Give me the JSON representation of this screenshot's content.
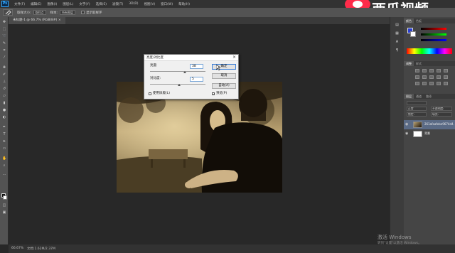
{
  "menubar": {
    "logo": "Ps",
    "items": [
      "文件(F)",
      "编辑(E)",
      "图像(I)",
      "图层(L)",
      "文字(Y)",
      "选择(S)",
      "滤镜(T)",
      "3D(D)",
      "视图(V)",
      "窗口(W)",
      "帮助(H)"
    ]
  },
  "options_bar": {
    "sample_size_label": "取样大小:",
    "sample_size_value": "取样点",
    "sample_label": "样本:",
    "sample_value": "所有图层",
    "show_ring_label": "显示取样环"
  },
  "document_tab": {
    "title": "未标题-1 @ 66.7% (RGB/8#) ×"
  },
  "dialog": {
    "title": "亮度/对比度",
    "close": "×",
    "brightness_label": "亮度:",
    "brightness_value": "38",
    "contrast_label": "对比度:",
    "contrast_value": "5",
    "ok_label": "确定",
    "cancel_label": "取消",
    "auto_label": "自动(A)",
    "use_legacy_label": "使用旧版(L)",
    "preview_label": "预览(P)",
    "preview_checked": "✓"
  },
  "right_panel": {
    "color_tabs": [
      "颜色",
      "色板"
    ],
    "adjust_tabs": [
      "调整",
      "样式"
    ],
    "layers_tabs": [
      "图层",
      "通道",
      "路径"
    ],
    "blend_mode": "正常",
    "opacity_label": "不透明度:",
    "lock_label": "锁定:",
    "fill_label": "填充:",
    "layers": [
      {
        "name": "261afaafebe9674d4...",
        "thumb": "photo"
      },
      {
        "name": "背景",
        "thumb": "white"
      }
    ]
  },
  "brand": {
    "text": "西瓜视频"
  },
  "status": {
    "zoom": "66.67%",
    "info": "文档:1.62M/2.37M"
  },
  "windows": {
    "activate": "激活 Windows",
    "activate_sub": "转到\"设置\"以激活 Windows。"
  },
  "colors": {
    "foreground": "#2a3fd1",
    "background": "#ffffff",
    "brand_accent": "#ff2b4a"
  }
}
